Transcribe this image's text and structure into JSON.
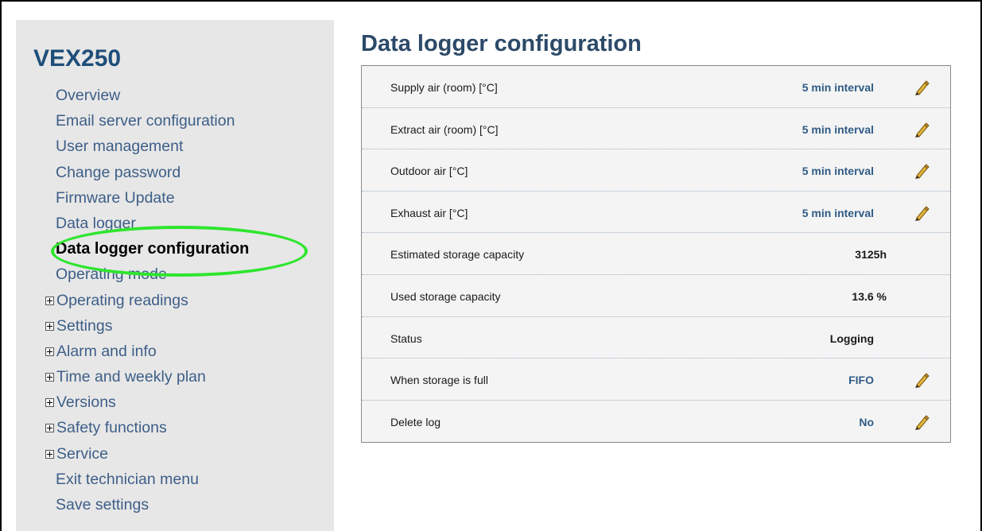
{
  "app": {
    "brand": "VEX250"
  },
  "sidebar": {
    "items": [
      {
        "label": "Overview",
        "expandable": false,
        "active": false
      },
      {
        "label": "Email server configuration",
        "expandable": false,
        "active": false
      },
      {
        "label": "User management",
        "expandable": false,
        "active": false
      },
      {
        "label": "Change password",
        "expandable": false,
        "active": false
      },
      {
        "label": "Firmware Update",
        "expandable": false,
        "active": false
      },
      {
        "label": "Data logger",
        "expandable": false,
        "active": false
      },
      {
        "label": "Data logger configuration",
        "expandable": false,
        "active": true
      },
      {
        "label": "Operating mode",
        "expandable": false,
        "active": false
      },
      {
        "label": "Operating readings",
        "expandable": true,
        "active": false
      },
      {
        "label": "Settings",
        "expandable": true,
        "active": false
      },
      {
        "label": "Alarm and info",
        "expandable": true,
        "active": false
      },
      {
        "label": "Time and weekly plan",
        "expandable": true,
        "active": false
      },
      {
        "label": "Versions",
        "expandable": true,
        "active": false
      },
      {
        "label": "Safety functions",
        "expandable": true,
        "active": false
      },
      {
        "label": "Service",
        "expandable": true,
        "active": false
      },
      {
        "label": "Exit technician menu",
        "expandable": false,
        "active": false
      },
      {
        "label": "Save settings",
        "expandable": false,
        "active": false
      }
    ]
  },
  "main": {
    "title": "Data logger configuration",
    "rows": [
      {
        "label": "Supply air (room) [°C]",
        "value": "5 min interval",
        "editable": true
      },
      {
        "label": "Extract air (room) [°C]",
        "value": "5 min interval",
        "editable": true
      },
      {
        "label": "Outdoor air [°C]",
        "value": "5 min interval",
        "editable": true
      },
      {
        "label": "Exhaust air [°C]",
        "value": "5 min interval",
        "editable": true
      },
      {
        "label": "Estimated storage capacity",
        "value": "3125h",
        "editable": false
      },
      {
        "label": "Used storage capacity",
        "value": "13.6 %",
        "editable": false
      },
      {
        "label": "Status",
        "value": "Logging",
        "editable": false
      },
      {
        "label": "When storage is full",
        "value": "FIFO",
        "editable": true
      },
      {
        "label": "Delete log",
        "value": "No",
        "editable": true
      }
    ]
  },
  "colors": {
    "brand": "#1f4e79",
    "link": "#3d5e88",
    "value": "#2f5b86",
    "highlight": "#2ee52e",
    "sidebar_bg": "#e7e7e7",
    "panel_bg": "#f4f4f4"
  },
  "icons": {
    "edit": "pencil-icon",
    "expand": "plus-box-icon"
  }
}
